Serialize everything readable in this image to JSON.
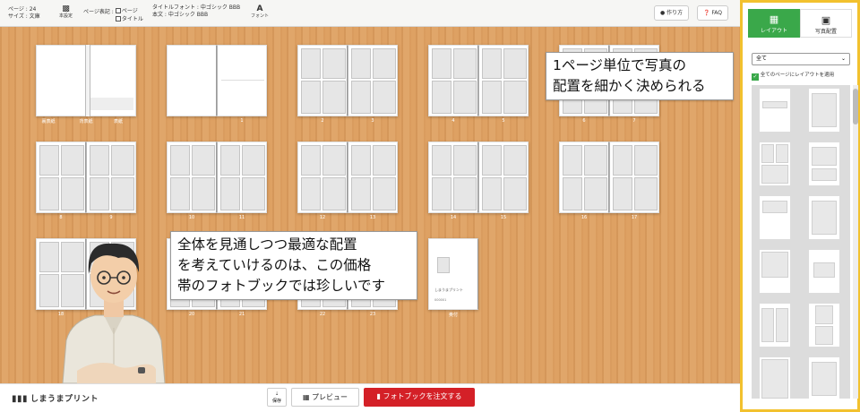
{
  "toolbar": {
    "pages_line": "ページ : 24",
    "size_line": "サイズ : 文庫",
    "book_settings": "本設定",
    "page_display": "ページ表記 :",
    "opt_page": "ページ",
    "opt_title": "タイトル",
    "title_font": "タイトルフォント : 中ゴシック BBB",
    "body_font": "本文 : 中ゴシック BBB",
    "font_btn": "フォント",
    "howto": "作り方",
    "faq": "FAQ"
  },
  "spreads": [
    {
      "type": "cover",
      "labels": [
        "裏表紙",
        "背表紙",
        "表紙"
      ]
    },
    {
      "type": "blank",
      "labels": [
        "",
        "1"
      ]
    },
    {
      "type": "grid",
      "labels": [
        "2",
        "3"
      ]
    },
    {
      "type": "grid",
      "labels": [
        "4",
        "5"
      ]
    },
    {
      "type": "grid",
      "labels": [
        "6",
        "7"
      ]
    },
    {
      "type": "grid",
      "labels": [
        "8",
        "9"
      ]
    },
    {
      "type": "grid",
      "labels": [
        "10",
        "11"
      ]
    },
    {
      "type": "grid",
      "labels": [
        "12",
        "13"
      ]
    },
    {
      "type": "grid",
      "labels": [
        "14",
        "15"
      ]
    },
    {
      "type": "grid",
      "labels": [
        "16",
        "17"
      ]
    },
    {
      "type": "grid",
      "labels": [
        "18",
        "19"
      ]
    },
    {
      "type": "grid",
      "labels": [
        "20",
        "21"
      ]
    },
    {
      "type": "grid",
      "labels": [
        "22",
        "23"
      ]
    },
    {
      "type": "colophon",
      "labels": [
        "奥付"
      ],
      "brand": "しまうまプリント",
      "meta": "000001"
    }
  ],
  "callout1": {
    "lines": [
      "1ページ単位で写真の",
      "配置を細かく決められる"
    ]
  },
  "callout2": {
    "lines": [
      "全体を見通しつつ最適な配置",
      "を考えていけるのは、この価格",
      "帯のフォトブックでは珍しいです"
    ]
  },
  "bottombar": {
    "logo": "しまうまプリント",
    "save": "保存",
    "preview": "プレビュー",
    "order": "フォトブックを注文する"
  },
  "sidebar": {
    "tab_layout": "レイアウト",
    "tab_photo": "写真配置",
    "filter": "全て",
    "apply_all": "全てのページにレイアウトを適用",
    "layout_count": 12
  },
  "colors": {
    "accent_green": "#3aa84a",
    "order_red": "#d42027",
    "highlight": "#f2c12e",
    "wood": "#dea163"
  },
  "icons": [
    "book-icon",
    "font-icon",
    "bulb-icon",
    "question-icon",
    "save-icon",
    "preview-book-icon",
    "order-book-icon",
    "layout-grid-icon",
    "photo-icon",
    "checkbox-icon"
  ]
}
